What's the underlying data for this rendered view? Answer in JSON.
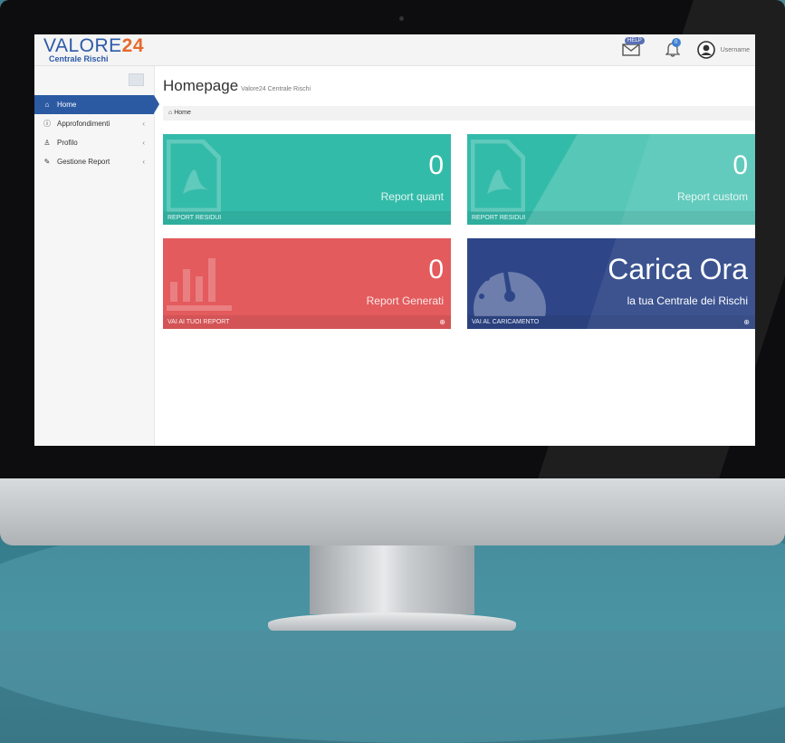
{
  "brand": {
    "name_part1": "VALORE",
    "name_part2": "24",
    "subtitle": "Centrale Rischi"
  },
  "header": {
    "help_badge": "HELP",
    "notifications_count": "0",
    "username": "Username"
  },
  "sidebar": {
    "items": [
      {
        "label": "Home",
        "icon": "home-icon",
        "active": true
      },
      {
        "label": "Approfondimenti",
        "icon": "info-icon",
        "chevron": "‹"
      },
      {
        "label": "Profilo",
        "icon": "user-icon",
        "chevron": "‹"
      },
      {
        "label": "Gestione Report",
        "icon": "edit-icon",
        "chevron": "‹"
      }
    ]
  },
  "page": {
    "title": "Homepage",
    "subtitle": "Valore24 Centrale Rischi",
    "breadcrumb": "Home"
  },
  "tiles": [
    {
      "value": "0",
      "label": "Report quant",
      "footer": "REPORT RESIDUI",
      "color": "#33bba9",
      "icon": "pdf-file-icon"
    },
    {
      "value": "0",
      "label": "Report custom",
      "footer": "REPORT RESIDUI",
      "color": "#33bba9",
      "icon": "pdf-file-icon"
    },
    {
      "value": "0",
      "label": "Report Generati",
      "footer": "VAI AI TUOI REPORT",
      "color": "#e35b5d",
      "icon": "bar-chart-icon"
    },
    {
      "value": "Carica Ora",
      "label": "la tua Centrale dei Rischi",
      "footer": "VAI AL CARICAMENTO",
      "color": "#2e4688",
      "icon": "gauge-icon"
    }
  ],
  "colors": {
    "accent": "#2b5aa3",
    "logo_orange": "#e46a2c",
    "teal": "#33bba9",
    "red": "#e35b5d",
    "navy": "#2e4688"
  }
}
